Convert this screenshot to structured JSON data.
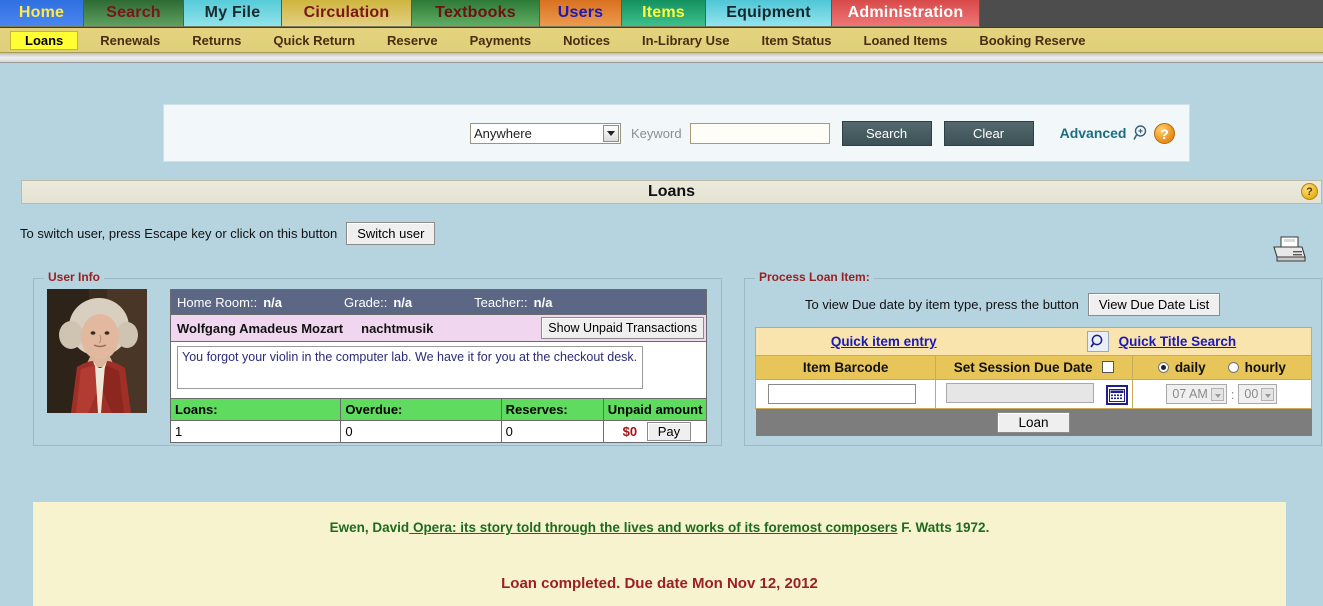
{
  "main_nav": [
    {
      "label": "Home",
      "key": "home"
    },
    {
      "label": "Search",
      "key": "search"
    },
    {
      "label": "My File",
      "key": "myfile"
    },
    {
      "label": "Circulation",
      "key": "circ"
    },
    {
      "label": "Textbooks",
      "key": "textbooks"
    },
    {
      "label": "Users",
      "key": "users"
    },
    {
      "label": "Items",
      "key": "items"
    },
    {
      "label": "Equipment",
      "key": "equip"
    },
    {
      "label": "Administration",
      "key": "admin"
    }
  ],
  "sub_nav": [
    {
      "label": "Loans",
      "active": true
    },
    {
      "label": "Renewals",
      "active": false
    },
    {
      "label": "Returns",
      "active": false
    },
    {
      "label": "Quick Return",
      "active": false
    },
    {
      "label": "Reserve",
      "active": false
    },
    {
      "label": "Payments",
      "active": false
    },
    {
      "label": "Notices",
      "active": false
    },
    {
      "label": "In-Library Use",
      "active": false
    },
    {
      "label": "Item Status",
      "active": false
    },
    {
      "label": "Loaned Items",
      "active": false
    },
    {
      "label": "Booking Reserve",
      "active": false
    }
  ],
  "search": {
    "scope_selected": "Anywhere",
    "keyword_label": "Keyword",
    "keyword_value": "",
    "search_button": "Search",
    "clear_button": "Clear",
    "advanced_link": "Advanced",
    "help_glyph": "?"
  },
  "page_title": "Loans",
  "title_help_glyph": "?",
  "switch_user": {
    "instruction": "To switch user, press Escape key or click on this button",
    "button": "Switch user"
  },
  "user_info": {
    "legend": "User Info",
    "home_room_label": "Home Room::",
    "home_room_value": "n/a",
    "grade_label": "Grade::",
    "grade_value": "n/a",
    "teacher_label": "Teacher::",
    "teacher_value": "n/a",
    "name": "Wolfgang Amadeus Mozart",
    "nickname": "nachtmusik",
    "unpaid_button": "Show Unpaid Transactions",
    "note": "You forgot your violin in the computer lab. We have it for you at the checkout desk.",
    "stats_headers": [
      "Loans:",
      "Overdue:",
      "Reserves:",
      "Unpaid amount"
    ],
    "stats_values": [
      "1",
      "0",
      "0"
    ],
    "unpaid_amount": "$0",
    "pay_button": "Pay"
  },
  "process_loan": {
    "legend": "Process Loan Item:",
    "due_date_instruction": "To view Due date by item type, press the button",
    "view_due_date_button": "View Due Date List",
    "quick_item_entry": "Quick item entry",
    "quick_title_search": "Quick Title Search",
    "col_item_barcode": "Item Barcode",
    "col_set_session_due_date": "Set Session Due Date",
    "item_barcode_value": "",
    "session_due_date_value": "",
    "session_due_date_checked": false,
    "radio_daily": "daily",
    "radio_hourly": "hourly",
    "radio_selected": "daily",
    "time_hour": "07 AM",
    "time_separator": ":",
    "time_minute": "00",
    "loan_button": "Loan"
  },
  "message": {
    "author": "Ewen, David",
    "title": " Opera: its story told through the lives and works of its foremost composers",
    "publisher": " F. Watts 1972.",
    "status": "Loan completed. Due date Mon Nov 12, 2012"
  },
  "icons": {
    "printer": "printer-icon",
    "magnifier_plus": "magnifier-plus-icon",
    "magnifier": "magnifier-icon",
    "calendar": "calendar-icon"
  },
  "colors": {
    "page_bg": "#b5d4e0",
    "subnav_bg": "#ded07a",
    "active_tab": "#ffff33",
    "stats_header": "#5fdc5f",
    "message_bg": "#f7f3cf",
    "message_green": "#1e6b1e",
    "message_red": "#9b2020"
  }
}
